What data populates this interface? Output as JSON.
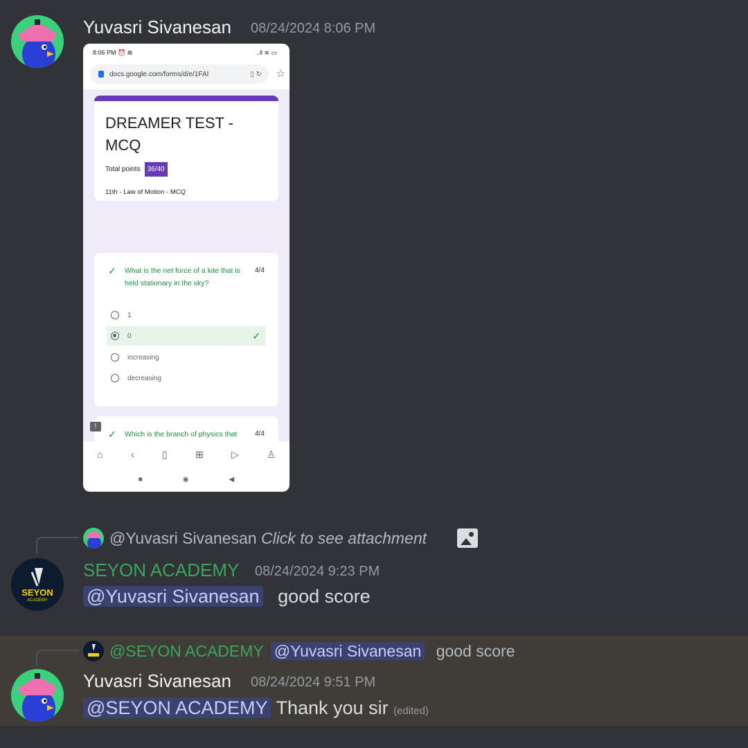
{
  "colors": {
    "background": "#313338",
    "highlight_row": "#403d38",
    "mention_bg": "#3c4270",
    "mention_text": "#c9cdfb",
    "academy_green": "#3ba55c",
    "form_purple": "#673ab7",
    "correct_green": "#1e8e3e"
  },
  "messages": [
    {
      "author": "Yuvasri Sivanesan",
      "timestamp": "08/24/2024 8:06 PM",
      "avatar_icon": "bird-avatar-icon",
      "attachment": {
        "status_time": "8:06 PM",
        "status_icons": "⏰ ⋒",
        "status_right": "..ll ≋ ▭",
        "url": "docs.google.com/forms/d/e/1FAI",
        "form": {
          "title": "DREAMER TEST - MCQ",
          "total_points_label": "Total points",
          "score": "36/40",
          "subtitle": "11th - Law of Motion - MCQ",
          "questions": [
            {
              "text": "What is the net force of a kite that is held stationary in the sky?",
              "points": "4/4",
              "options": [
                "1",
                "0",
                "increasing",
                "decreasing"
              ],
              "selected_index": 1
            },
            {
              "text": "Which is the branch of physics that deals with the motion of a body by considering the cause?",
              "points": "4/4"
            }
          ]
        }
      }
    },
    {
      "reply_to": {
        "mention": "@Yuvasri Sivanesan",
        "text": "Click to see attachment"
      },
      "author": "SEYON ACADEMY",
      "avatar_text": "SEYON",
      "avatar_subtext": "ACADEMY",
      "timestamp": "08/24/2024 9:23 PM",
      "mention": "@Yuvasri Sivanesan",
      "text": "good score"
    },
    {
      "reply_to": {
        "author": "@SEYON ACADEMY",
        "mention": "@Yuvasri Sivanesan",
        "text": "good score"
      },
      "author": "Yuvasri Sivanesan",
      "timestamp": "08/24/2024 9:51 PM",
      "mention": "@SEYON ACADEMY",
      "text": "Thank you sir",
      "edited": "(edited)"
    }
  ]
}
